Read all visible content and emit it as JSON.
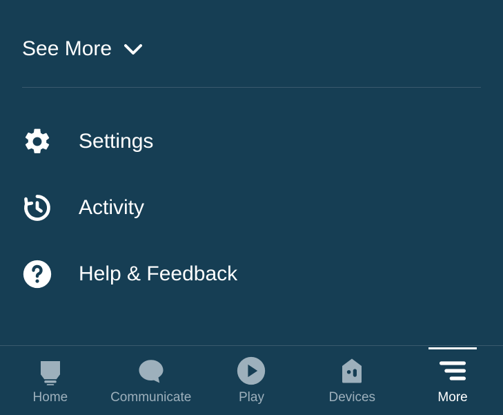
{
  "see_more": {
    "label": "See More"
  },
  "menu": [
    {
      "label": "Settings",
      "icon": "gear"
    },
    {
      "label": "Activity",
      "icon": "history"
    },
    {
      "label": "Help & Feedback",
      "icon": "question"
    }
  ],
  "nav": [
    {
      "label": "Home",
      "icon": "home",
      "active": false
    },
    {
      "label": "Communicate",
      "icon": "chat",
      "active": false
    },
    {
      "label": "Play",
      "icon": "play",
      "active": false
    },
    {
      "label": "Devices",
      "icon": "devices",
      "active": false
    },
    {
      "label": "More",
      "icon": "more",
      "active": true
    }
  ],
  "colors": {
    "bg": "#163e54",
    "fg": "#ffffff",
    "muted": "#9db0bc",
    "divider": "#3a5a6e"
  }
}
